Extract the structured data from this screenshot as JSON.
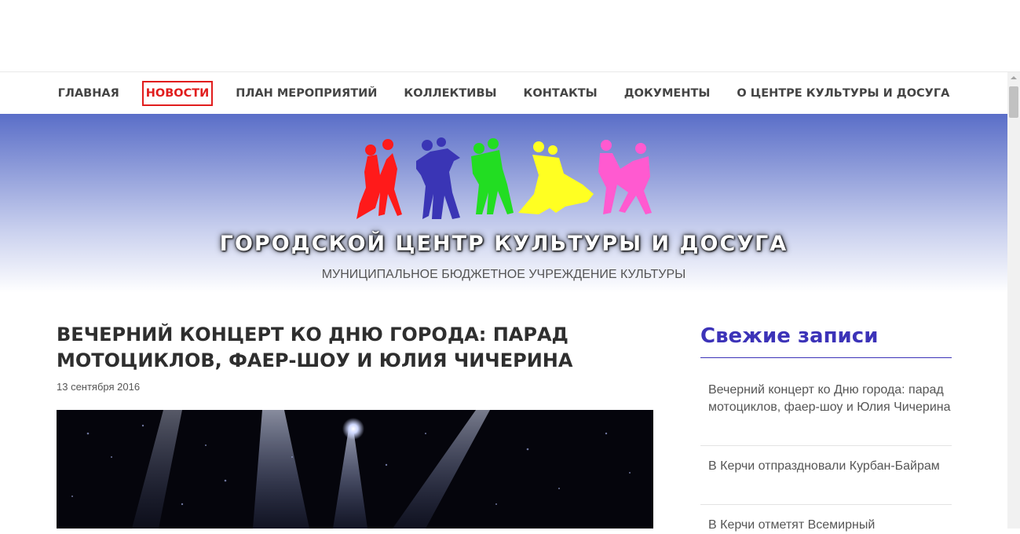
{
  "nav": {
    "items": [
      {
        "label": "ГЛАВНАЯ"
      },
      {
        "label": "НОВОСТИ"
      },
      {
        "label": "ПЛАН МЕРОПРИЯТИЙ"
      },
      {
        "label": "КОЛЛЕКТИВЫ"
      },
      {
        "label": "КОНТАКТЫ"
      },
      {
        "label": "ДОКУМЕНТЫ"
      },
      {
        "label": "О ЦЕНТРЕ КУЛЬТУРЫ И ДОСУГА"
      }
    ],
    "active_index": 1
  },
  "header": {
    "title": "ГОРОДСКОЙ ЦЕНТР КУЛЬТУРЫ И ДОСУГА",
    "subtitle": "МУНИЦИПАЛЬНОЕ БЮДЖЕТНОЕ УЧРЕЖДЕНИЕ КУЛЬТУРЫ",
    "logo_colors": [
      "#ff1a1a",
      "#3a35b5",
      "#22dd22",
      "#ffff22",
      "#ff5ad0"
    ]
  },
  "article": {
    "title": "ВЕЧЕРНИЙ КОНЦЕРТ КО ДНЮ ГОРОДА: ПАРАД МОТОЦИКЛОВ, ФАЕР-ШОУ И ЮЛИЯ ЧИЧЕРИНА",
    "date": "13 сентября 2016"
  },
  "sidebar": {
    "title": "Свежие записи",
    "posts": [
      {
        "text": "Вечерний концерт ко Дню города: парад мотоциклов, фаер-шоу и Юлия Чичерина"
      },
      {
        "text": "В Керчи отпраздновали Курбан-Байрам"
      },
      {
        "text": "В Керчи отметят Всемирный"
      }
    ]
  },
  "colors": {
    "accent": "#e11d1d",
    "sidebar_title": "#3c33b8"
  }
}
